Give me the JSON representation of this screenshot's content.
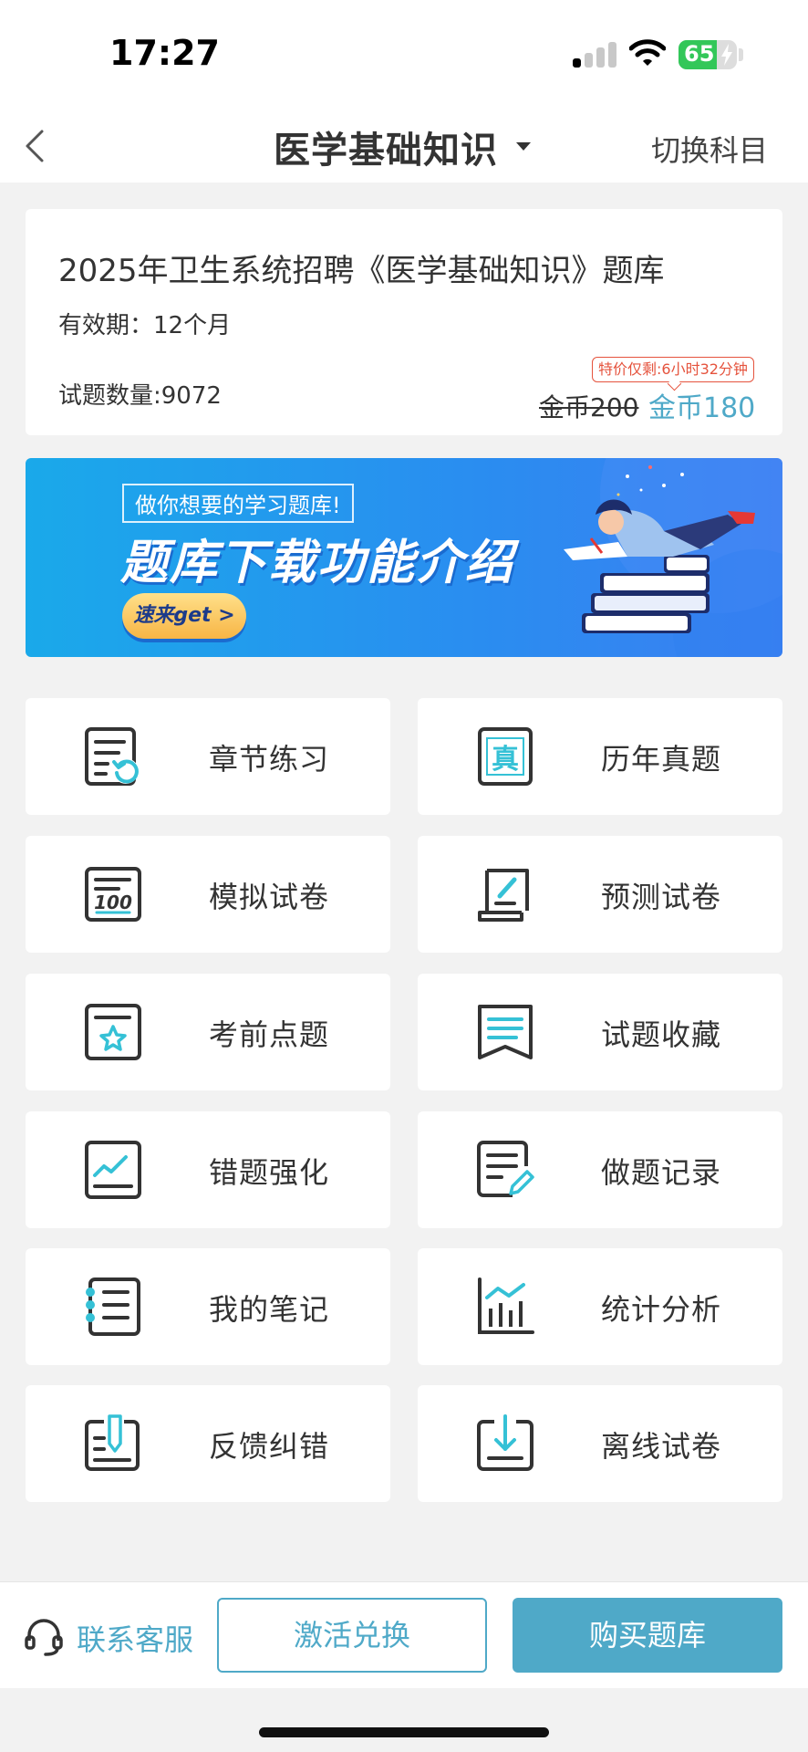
{
  "status_bar": {
    "time": "17:27",
    "battery_level": "65",
    "battery_fraction": 0.65,
    "signal_bars_on": 1,
    "signal_bars_total": 4
  },
  "nav": {
    "title": "医学基础知识",
    "switch_label": "切换科目"
  },
  "product": {
    "title": "2025年卫生系统招聘《医学基础知识》题库",
    "validity": "有效期：12个月",
    "question_count": "试题数量:9072",
    "promo_badge": "特价仅剩:6小时32分钟",
    "old_price": "金币200",
    "new_price": "金币180"
  },
  "banner": {
    "tag": "做你想要的学习题库!",
    "headline": "题库下载功能介绍",
    "cta": "速来get >"
  },
  "features": [
    {
      "label": "章节练习",
      "icon": "chapter-practice-icon"
    },
    {
      "label": "历年真题",
      "icon": "past-exams-icon"
    },
    {
      "label": "模拟试卷",
      "icon": "mock-exam-icon"
    },
    {
      "label": "预测试卷",
      "icon": "predicted-exam-icon"
    },
    {
      "label": "考前点题",
      "icon": "pre-exam-tips-icon"
    },
    {
      "label": "试题收藏",
      "icon": "favorites-icon"
    },
    {
      "label": "错题强化",
      "icon": "wrong-questions-icon"
    },
    {
      "label": "做题记录",
      "icon": "practice-record-icon"
    },
    {
      "label": "我的笔记",
      "icon": "notes-icon"
    },
    {
      "label": "统计分析",
      "icon": "statistics-icon"
    },
    {
      "label": "反馈纠错",
      "icon": "feedback-icon"
    },
    {
      "label": "离线试卷",
      "icon": "offline-download-icon"
    }
  ],
  "bottom_bar": {
    "service_label": "联系客服",
    "activate_label": "激活兑换",
    "buy_label": "购买题库"
  },
  "colors": {
    "accent": "#4fa9c8",
    "icon_teal": "#35c1d6",
    "promo_red": "#e5533d",
    "background": "#f2f2f2"
  }
}
